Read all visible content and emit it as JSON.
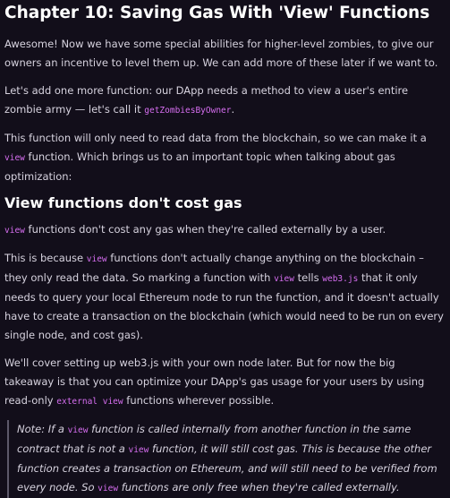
{
  "page": {
    "title": "Chapter 10: Saving Gas With 'View' Functions",
    "p1": "Awesome! Now we have some special abilities for higher-level zombies, to give our owners an incentive to level them up. We can add more of these later if we want to.",
    "p2": {
      "text1": "Let's add one more function: our DApp needs a method to view a user's entire zombie army — let's call it ",
      "code1": "getZombiesByOwner",
      "text2": "."
    },
    "p3": {
      "text1": "This function will only need to read data from the blockchain, so we can make it a ",
      "code1": "view",
      "text2": " function. Which brings us to an important topic when talking about gas optimization:"
    },
    "heading2": "View functions don't cost gas",
    "p4": {
      "code1": "view",
      "text1": " functions don't cost any gas when they're called externally by a user."
    },
    "p5": {
      "text1": "This is because ",
      "code1": "view",
      "text2": " functions don't actually change anything on the blockchain – they only read the data. So marking a function with ",
      "code2": "view",
      "text3": " tells ",
      "code3": "web3.js",
      "text4": " that it only needs to query your local Ethereum node to run the function, and it doesn't actually have to create a transaction on the blockchain (which would need to be run on every single node, and cost gas)."
    },
    "p6": {
      "text1": "We'll cover setting up web3.js with your own node later. But for now the big takeaway is that you can optimize your DApp's gas usage for your users by using read-only ",
      "code1": "external view",
      "text2": " functions wherever possible."
    },
    "note": {
      "text1": "Note: If a ",
      "code1": "view",
      "text2": " function is called internally from another function in the same contract that is not a ",
      "code2": "view",
      "text3": " function, it will still cost gas. This is because the other function creates a transaction on Ethereum, and will still need to be verified from every node. So ",
      "code3": "view",
      "text4": " functions are only free when they're called externally."
    }
  }
}
